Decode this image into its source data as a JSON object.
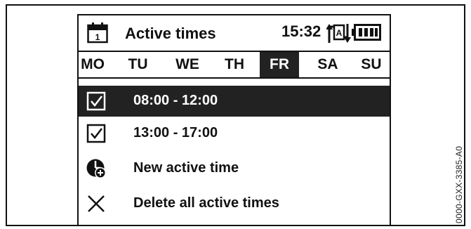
{
  "header": {
    "title": "Active times",
    "clock": "15:32",
    "calendar_icon_day": "1",
    "auto_mode_icon_letter": "A"
  },
  "days": [
    "MO",
    "TU",
    "WE",
    "TH",
    "FR",
    "SA",
    "SU"
  ],
  "selected_day": "FR",
  "rows": [
    {
      "label": "08:00 - 12:00",
      "icon": "checkbox-checked-icon",
      "selected": true
    },
    {
      "label": "13:00 - 17:00",
      "icon": "checkbox-checked-icon",
      "selected": false
    },
    {
      "label": "New active time",
      "icon": "add-time-icon",
      "selected": false
    },
    {
      "label": "Delete all active times",
      "icon": "close-icon",
      "selected": false
    }
  ],
  "document_code": "0000-GXX-3385-A0",
  "colors": {
    "selection_bg": "#222222",
    "foreground": "#111111",
    "background": "#ffffff"
  }
}
